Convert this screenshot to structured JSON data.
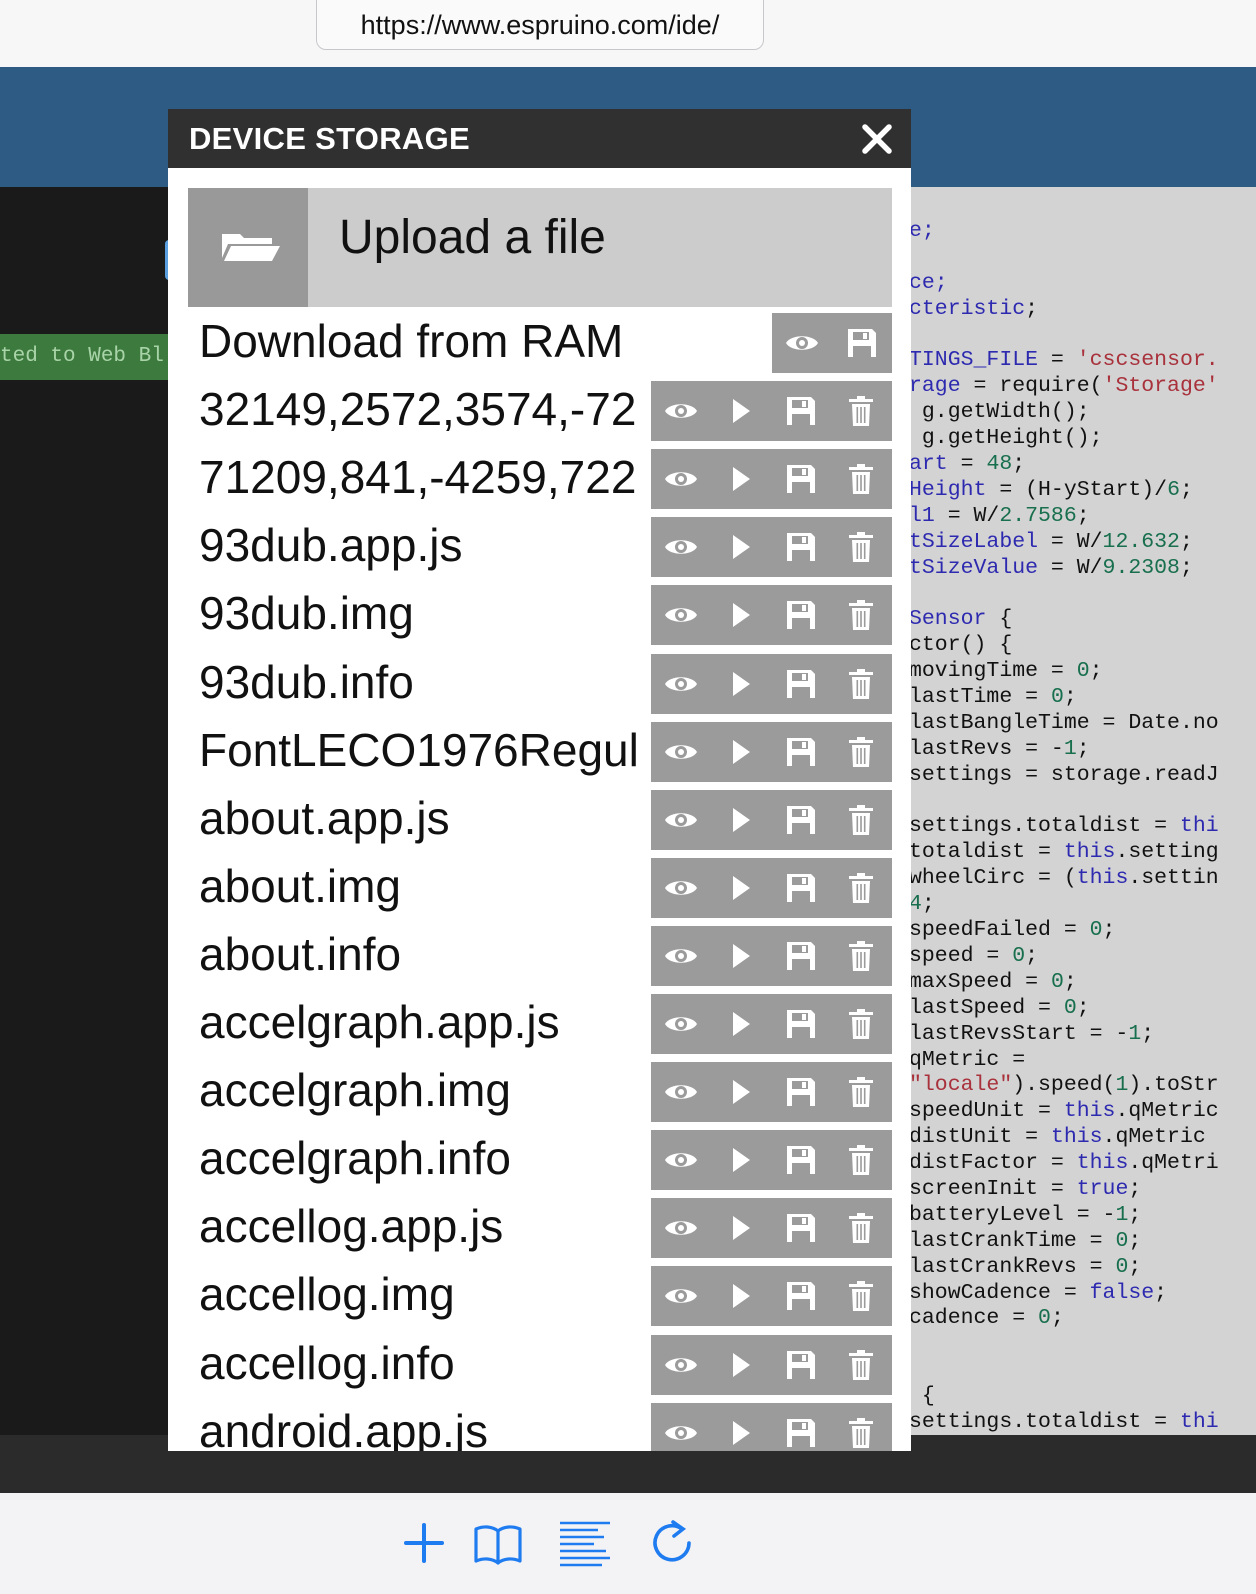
{
  "browser": {
    "url": "https://www.espruino.com/ide/",
    "toolbar": {
      "icons": [
        "plus-icon",
        "bookmarks-icon",
        "reader-icon",
        "reload-icon"
      ],
      "accent": "#1f7cf0"
    }
  },
  "ide": {
    "terminal_banner": "ted to Web Bl",
    "code_lines": [
      [
        {
          "t": "e;",
          "c": "kw"
        }
      ],
      [],
      [
        {
          "t": "ce;",
          "c": "kw"
        }
      ],
      [
        {
          "t": "cteristic",
          "c": "kw"
        },
        {
          "t": ";"
        }
      ],
      [],
      [
        {
          "t": "TINGS_FILE",
          "c": "kw"
        },
        {
          "t": " = "
        },
        {
          "t": "'cscsensor.",
          "c": "str"
        }
      ],
      [
        {
          "t": "rage",
          "c": "kw"
        },
        {
          "t": " = require("
        },
        {
          "t": "'Storage'",
          "c": "str"
        }
      ],
      [
        {
          "t": " g.getWidth();"
        }
      ],
      [
        {
          "t": " g.getHeight();"
        }
      ],
      [
        {
          "t": "art",
          "c": "kw"
        },
        {
          "t": " = "
        },
        {
          "t": "48",
          "c": "num"
        },
        {
          "t": ";"
        }
      ],
      [
        {
          "t": "Height",
          "c": "kw"
        },
        {
          "t": " = (H-yStart)/"
        },
        {
          "t": "6",
          "c": "num"
        },
        {
          "t": ";"
        }
      ],
      [
        {
          "t": "l1",
          "c": "kw"
        },
        {
          "t": " = W/"
        },
        {
          "t": "2.7586",
          "c": "num"
        },
        {
          "t": ";"
        }
      ],
      [
        {
          "t": "tSizeLabel",
          "c": "kw"
        },
        {
          "t": " = W/"
        },
        {
          "t": "12.632",
          "c": "num"
        },
        {
          "t": ";"
        }
      ],
      [
        {
          "t": "tSizeValue",
          "c": "kw"
        },
        {
          "t": " = W/"
        },
        {
          "t": "9.2308",
          "c": "num"
        },
        {
          "t": ";"
        }
      ],
      [],
      [
        {
          "t": "Sensor",
          "c": "kw"
        },
        {
          "t": " {"
        }
      ],
      [
        {
          "t": "ctor() {"
        }
      ],
      [
        {
          "t": "movingTime = "
        },
        {
          "t": "0",
          "c": "num"
        },
        {
          "t": ";"
        }
      ],
      [
        {
          "t": "lastTime = "
        },
        {
          "t": "0",
          "c": "num"
        },
        {
          "t": ";"
        }
      ],
      [
        {
          "t": "lastBangleTime = Date.no"
        }
      ],
      [
        {
          "t": "lastRevs = -"
        },
        {
          "t": "1",
          "c": "num"
        },
        {
          "t": ";"
        }
      ],
      [
        {
          "t": "settings = storage.readJ"
        }
      ],
      [],
      [
        {
          "t": "settings.totaldist = "
        },
        {
          "t": "thi",
          "c": "kw"
        }
      ],
      [
        {
          "t": "totaldist = "
        },
        {
          "t": "this",
          "c": "kw"
        },
        {
          "t": ".setting"
        }
      ],
      [
        {
          "t": "wheelCirc = ("
        },
        {
          "t": "this",
          "c": "kw"
        },
        {
          "t": ".settin"
        }
      ],
      [
        {
          "t": "4",
          "c": "num"
        },
        {
          "t": ";"
        }
      ],
      [
        {
          "t": "speedFailed = "
        },
        {
          "t": "0",
          "c": "num"
        },
        {
          "t": ";"
        }
      ],
      [
        {
          "t": "speed = "
        },
        {
          "t": "0",
          "c": "num"
        },
        {
          "t": ";"
        }
      ],
      [
        {
          "t": "maxSpeed = "
        },
        {
          "t": "0",
          "c": "num"
        },
        {
          "t": ";"
        }
      ],
      [
        {
          "t": "lastSpeed = "
        },
        {
          "t": "0",
          "c": "num"
        },
        {
          "t": ";"
        }
      ],
      [
        {
          "t": "lastRevsStart = -"
        },
        {
          "t": "1",
          "c": "num"
        },
        {
          "t": ";"
        }
      ],
      [
        {
          "t": "qMetric ="
        }
      ],
      [
        {
          "t": "\"locale\"",
          "c": "str"
        },
        {
          "t": ").speed("
        },
        {
          "t": "1",
          "c": "num"
        },
        {
          "t": ").toStr"
        }
      ],
      [
        {
          "t": "speedUnit = "
        },
        {
          "t": "this",
          "c": "kw"
        },
        {
          "t": ".qMetric"
        }
      ],
      [
        {
          "t": "distUnit = "
        },
        {
          "t": "this",
          "c": "kw"
        },
        {
          "t": ".qMetric "
        }
      ],
      [
        {
          "t": "distFactor = "
        },
        {
          "t": "this",
          "c": "kw"
        },
        {
          "t": ".qMetri"
        }
      ],
      [
        {
          "t": "screenInit = "
        },
        {
          "t": "true",
          "c": "kw"
        },
        {
          "t": ";"
        }
      ],
      [
        {
          "t": "batteryLevel = -"
        },
        {
          "t": "1",
          "c": "num"
        },
        {
          "t": ";"
        }
      ],
      [
        {
          "t": "lastCrankTime = "
        },
        {
          "t": "0",
          "c": "num"
        },
        {
          "t": ";"
        }
      ],
      [
        {
          "t": "lastCrankRevs = "
        },
        {
          "t": "0",
          "c": "num"
        },
        {
          "t": ";"
        }
      ],
      [
        {
          "t": "showCadence = "
        },
        {
          "t": "false",
          "c": "kw"
        },
        {
          "t": ";"
        }
      ],
      [
        {
          "t": "cadence = "
        },
        {
          "t": "0",
          "c": "num"
        },
        {
          "t": ";"
        }
      ],
      [],
      [],
      [
        {
          "t": " {"
        }
      ],
      [
        {
          "t": "settings.totaldist = "
        },
        {
          "t": "thi",
          "c": "kw"
        }
      ]
    ]
  },
  "modal": {
    "title": "DEVICE STORAGE",
    "close_icon": "close-icon",
    "upload": {
      "label": "Upload a file",
      "icon": "folder-open-icon"
    },
    "ram_row": {
      "label": "Download from RAM",
      "actions": [
        "view-icon",
        "save-icon"
      ]
    },
    "files": [
      "32149,2572,3574,-72",
      "71209,841,-4259,722",
      "93dub.app.js",
      "93dub.img",
      "93dub.info",
      "FontLECO1976Regul",
      "about.app.js",
      "about.img",
      "about.info",
      "accelgraph.app.js",
      "accelgraph.img",
      "accelgraph.info",
      "accellog.app.js",
      "accellog.img",
      "accellog.info",
      "android.app.js"
    ],
    "file_actions": [
      "view-icon",
      "run-icon",
      "save-icon",
      "delete-icon"
    ],
    "colors": {
      "titlebar": "#303030",
      "upload_bg": "#cccccc",
      "upload_icon_bg": "#999999",
      "action_bg": "#9b9b9b",
      "icon": "#ffffff"
    }
  }
}
